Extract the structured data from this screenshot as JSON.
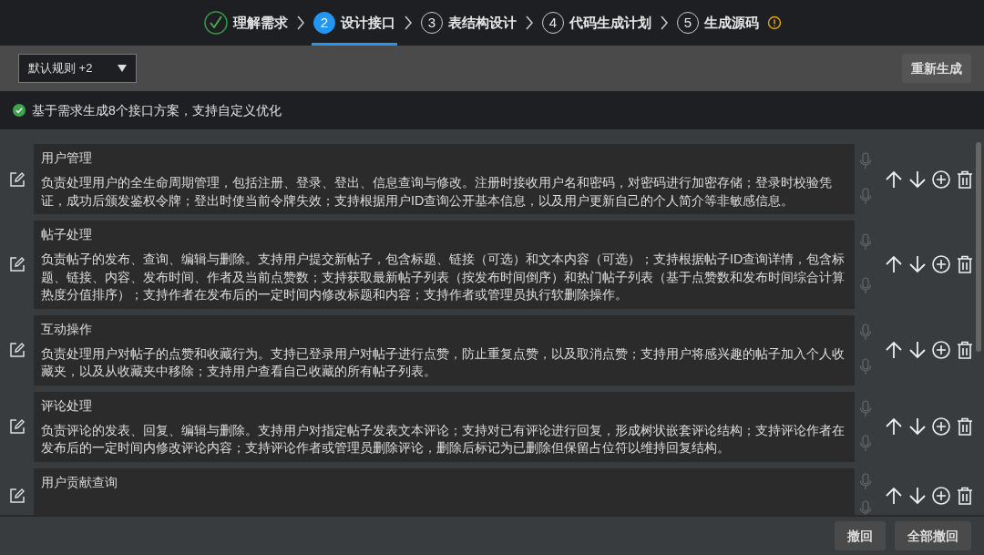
{
  "steps": [
    {
      "label": "理解需求",
      "done": true,
      "selected": false
    },
    {
      "number": "2",
      "label": "设计接口",
      "done": false,
      "selected": true
    },
    {
      "number": "3",
      "label": "表结构设计",
      "done": false,
      "selected": false
    },
    {
      "number": "4",
      "label": "代码生成计划",
      "done": false,
      "selected": false
    },
    {
      "number": "5",
      "label": "生成源码",
      "done": false,
      "selected": false
    }
  ],
  "rules_dropdown": {
    "value": "默认规则 +2"
  },
  "regenerate_button": "重新生成",
  "status": {
    "text": "基于需求生成8个接口方案，支持自定义优化",
    "success": true
  },
  "interfaces": [
    {
      "title": "用户管理",
      "description": "负责处理用户的全生命周期管理，包括注册、登录、登出、信息查询与修改。注册时接收用户名和密码，对密码进行加密存储；登录时校验凭证，成功后颁发鉴权令牌；登出时使当前令牌失效；支持根据用户ID查询公开基本信息，以及用户更新自己的个人简介等非敏感信息。"
    },
    {
      "title": "帖子处理",
      "description": "负责帖子的发布、查询、编辑与删除。支持用户提交新帖子，包含标题、链接（可选）和文本内容（可选）；支持根据帖子ID查询详情，包含标题、链接、内容、发布时间、作者及当前点赞数；支持获取最新帖子列表（按发布时间倒序）和热门帖子列表（基于点赞数和发布时间综合计算热度分值排序）；支持作者在发布后的一定时间内修改标题和内容；支持作者或管理员执行软删除操作。"
    },
    {
      "title": "互动操作",
      "description": "负责处理用户对帖子的点赞和收藏行为。支持已登录用户对帖子进行点赞，防止重复点赞，以及取消点赞；支持用户将感兴趣的帖子加入个人收藏夹，以及从收藏夹中移除；支持用户查看自己收藏的所有帖子列表。"
    },
    {
      "title": "评论处理",
      "description": "负责评论的发表、回复、编辑与删除。支持用户对指定帖子发表文本评论；支持对已有评论进行回复，形成树状嵌套评论结构；支持评论作者在发布后的一定时间内修改评论内容；支持评论作者或管理员删除评论，删除后标记为已删除但保留占位符以维持回复结构。"
    },
    {
      "title": "用户贡献查询"
    }
  ],
  "footer_buttons": [
    "撤回",
    "全部撤回"
  ]
}
